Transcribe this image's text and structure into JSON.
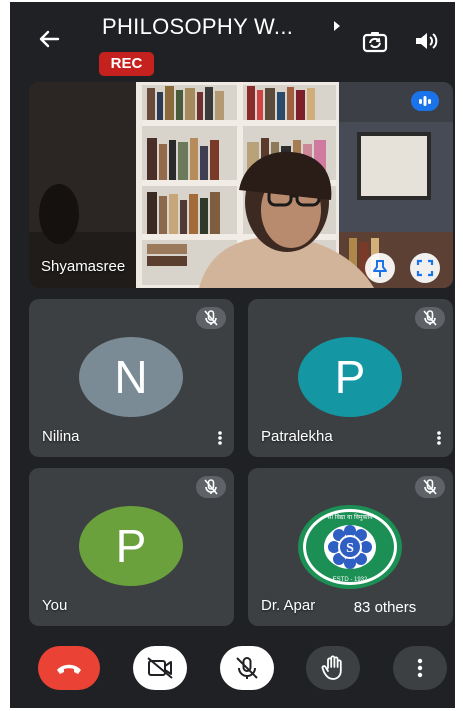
{
  "header": {
    "title": "PHILOSOPHY W...",
    "rec_label": "REC"
  },
  "main_tile": {
    "name": "Shyamasree"
  },
  "participants": [
    {
      "initial": "N",
      "name": "Nilina",
      "avatar_color": "#7a8b96"
    },
    {
      "initial": "P",
      "name": "Patralekha",
      "avatar_color": "#1497a3"
    },
    {
      "initial": "P",
      "name": "You",
      "avatar_color": "#6aa13d"
    },
    {
      "initial": "",
      "name": "Dr. Apar",
      "avatar_color": "#1b8f54"
    }
  ],
  "others_label": "83 others",
  "logo": {
    "top_text": "सा विद्या या विमुक्तये",
    "letter": "S",
    "estd_text": "ESTD - 1932"
  },
  "colors": {
    "end_call": "#ea4335",
    "rec": "#c5221f",
    "tile_bg": "#3c4043",
    "app_bg": "#202124",
    "activity": "#1a73e8"
  },
  "icons": {
    "back": "arrow-left-icon",
    "caret": "caret-right-icon",
    "switch_camera": "switch-camera-icon",
    "speaker": "speaker-icon",
    "pin": "pin-icon",
    "fullscreen": "fullscreen-icon",
    "mute": "mic-off-icon",
    "more": "more-vert-icon",
    "end_call": "phone-hangup-icon",
    "camera_off": "camera-off-icon",
    "hand": "raise-hand-icon"
  }
}
